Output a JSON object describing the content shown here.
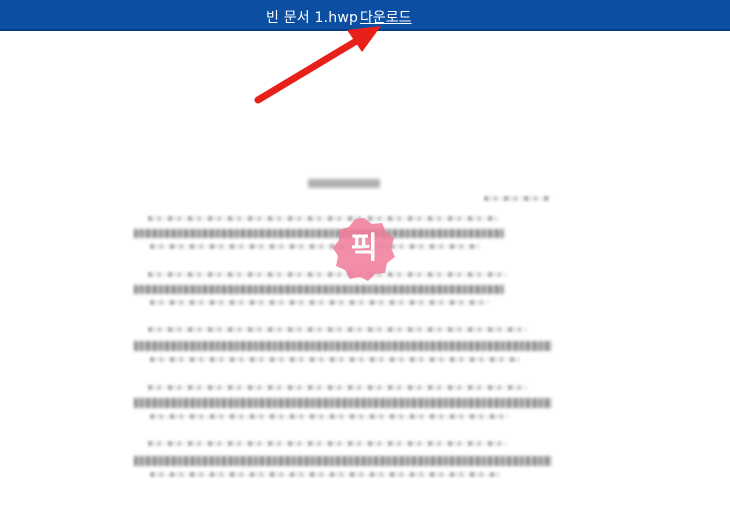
{
  "header": {
    "document_title": "빈 문서 1.hwp",
    "download_label": "다운로드"
  },
  "stamp": {
    "text": "픽",
    "color": "#f07a98"
  },
  "colors": {
    "header_bar": "#0b4ea2",
    "arrow": "#e8201a"
  }
}
